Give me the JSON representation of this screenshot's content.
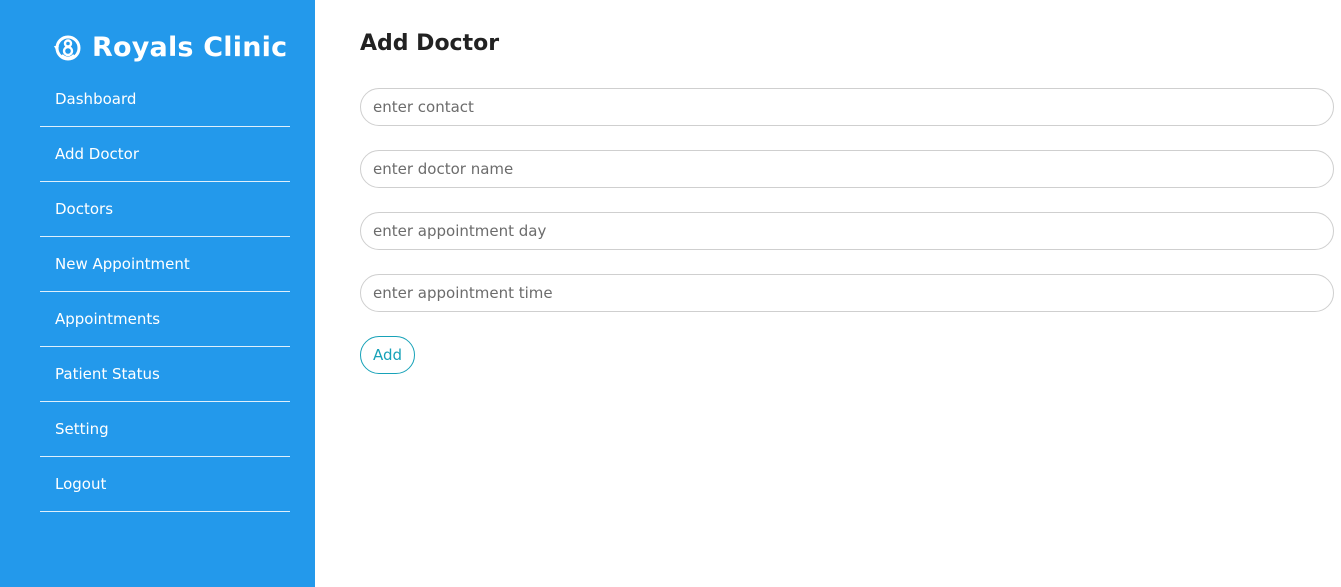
{
  "brand": {
    "name": "Royals Clinic",
    "icon": "clinic-logo-icon",
    "color": "#2399eb"
  },
  "sidebar": {
    "items": [
      {
        "label": "Dashboard"
      },
      {
        "label": "Add Doctor"
      },
      {
        "label": "Doctors"
      },
      {
        "label": "New Appointment"
      },
      {
        "label": "Appointments"
      },
      {
        "label": "Patient Status"
      },
      {
        "label": "Setting"
      },
      {
        "label": "Logout"
      }
    ]
  },
  "main": {
    "title": "Add Doctor",
    "form": {
      "contact": {
        "value": "",
        "placeholder": "enter contact"
      },
      "doctor_name": {
        "value": "",
        "placeholder": "enter doctor name"
      },
      "appointment_day": {
        "value": "",
        "placeholder": "enter appointment day"
      },
      "appointment_time": {
        "value": "",
        "placeholder": "enter appointment time"
      },
      "submit_label": "Add",
      "accent_color": "#17a2b8"
    }
  }
}
